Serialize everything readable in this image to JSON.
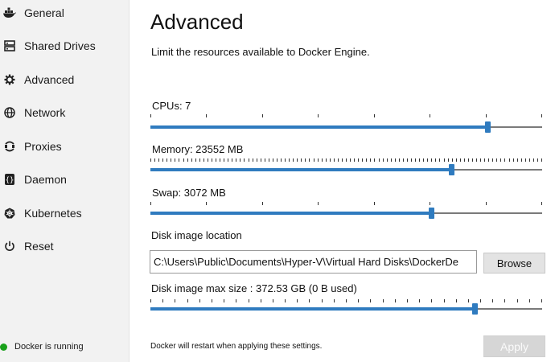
{
  "sidebar": {
    "items": [
      {
        "label": "General",
        "icon": "docker-whale-icon"
      },
      {
        "label": "Shared Drives",
        "icon": "drive-icon"
      },
      {
        "label": "Advanced",
        "icon": "gear-icon"
      },
      {
        "label": "Network",
        "icon": "globe-icon"
      },
      {
        "label": "Proxies",
        "icon": "proxies-icon"
      },
      {
        "label": "Daemon",
        "icon": "daemon-braces-icon"
      },
      {
        "label": "Kubernetes",
        "icon": "kubernetes-wheel-icon"
      },
      {
        "label": "Reset",
        "icon": "power-icon"
      }
    ],
    "active": "Advanced",
    "status": {
      "text": "Docker is running",
      "color": "#19a11b"
    }
  },
  "main": {
    "title": "Advanced",
    "subtitle": "Limit the resources available to Docker Engine.",
    "cpus": {
      "label": "CPUs: 7",
      "level": 0.86
    },
    "memory": {
      "label": "Memory: 23552 MB",
      "level": 0.767
    },
    "swap": {
      "label": "Swap: 3072 MB",
      "level": 0.717
    },
    "disk_location": {
      "label": "Disk image location",
      "value": "C:\\Users\\Public\\Documents\\Hyper-V\\Virtual Hard Disks\\DockerDe",
      "browse_label": "Browse"
    },
    "disk_size": {
      "label": "Disk image max size : 372.53 GB (0 B  used)",
      "level": 0.828
    },
    "restart_note": "Docker will restart when applying these settings.",
    "apply_label": "Apply"
  },
  "colors": {
    "accent": "#2f7bbf",
    "sidebar_bg": "#f2f2f2",
    "status_green": "#19a11b"
  }
}
